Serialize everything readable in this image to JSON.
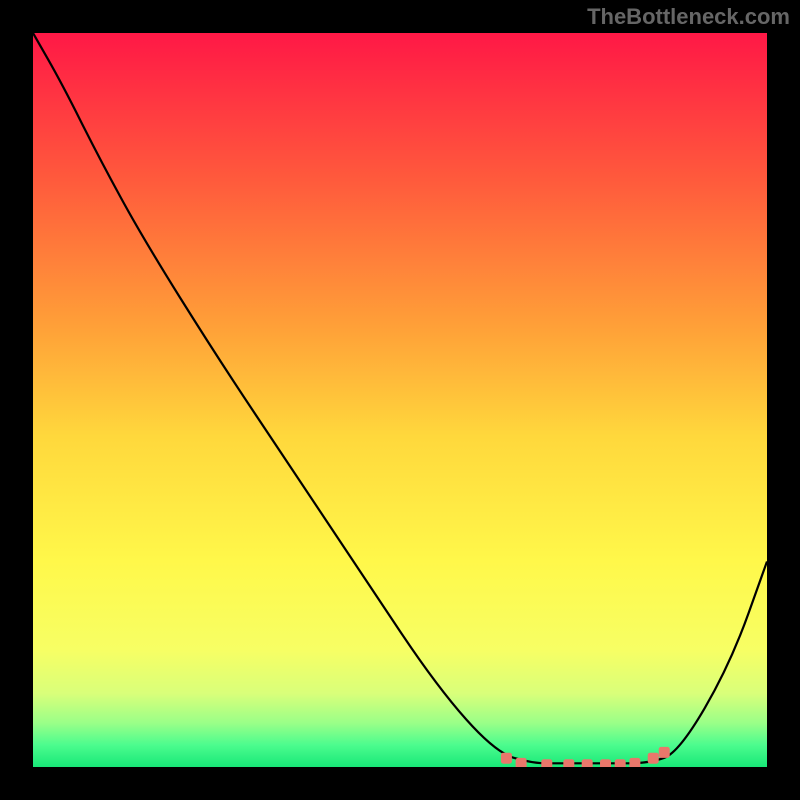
{
  "watermark": "TheBottleneck.com",
  "chart_data": {
    "type": "line",
    "title": "",
    "xlabel": "",
    "ylabel": "",
    "xlim": [
      0,
      1
    ],
    "ylim": [
      0,
      1
    ],
    "grid": false,
    "series": [
      {
        "name": "curve",
        "x": [
          0.0,
          0.04,
          0.09,
          0.15,
          0.25,
          0.35,
          0.45,
          0.55,
          0.63,
          0.68,
          0.72,
          0.78,
          0.84,
          0.88,
          0.95,
          1.0
        ],
        "y": [
          1.0,
          0.93,
          0.83,
          0.72,
          0.56,
          0.41,
          0.26,
          0.11,
          0.02,
          0.005,
          0.005,
          0.005,
          0.005,
          0.02,
          0.14,
          0.28
        ]
      }
    ],
    "markers": {
      "x": [
        0.645,
        0.665,
        0.7,
        0.73,
        0.755,
        0.78,
        0.8,
        0.82,
        0.845,
        0.86
      ],
      "y": [
        0.012,
        0.005,
        0.003,
        0.003,
        0.003,
        0.003,
        0.003,
        0.005,
        0.012,
        0.02
      ]
    },
    "background_gradient": {
      "stops": [
        {
          "offset": 0.0,
          "color": "#ff1846"
        },
        {
          "offset": 0.2,
          "color": "#ff5a3c"
        },
        {
          "offset": 0.4,
          "color": "#ffa038"
        },
        {
          "offset": 0.55,
          "color": "#ffd83c"
        },
        {
          "offset": 0.72,
          "color": "#fff84a"
        },
        {
          "offset": 0.84,
          "color": "#f7ff64"
        },
        {
          "offset": 0.9,
          "color": "#d9ff7a"
        },
        {
          "offset": 0.94,
          "color": "#9aff88"
        },
        {
          "offset": 0.97,
          "color": "#4cfc8e"
        },
        {
          "offset": 1.0,
          "color": "#18e878"
        }
      ]
    }
  }
}
